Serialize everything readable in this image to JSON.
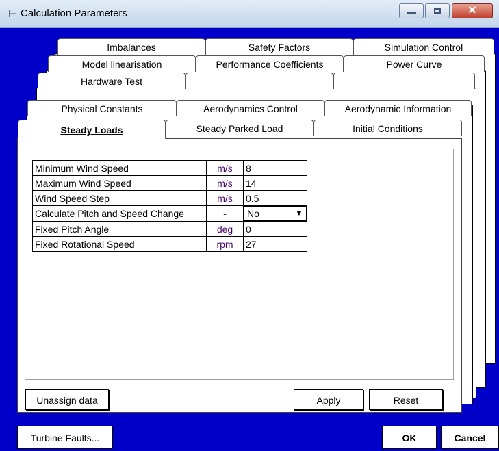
{
  "window": {
    "title": "Calculation Parameters",
    "close_glyph": "✕",
    "app_icon": "wind-turbine-icon"
  },
  "tabs": {
    "row1": [
      "Imbalances",
      "Safety Factors",
      "Simulation Control"
    ],
    "row2": [
      "Model linearisation",
      "Performance Coefficients",
      "Power Curve"
    ],
    "row3": [
      "Hardware Test",
      "",
      ""
    ],
    "row4": [
      "Physical Constants",
      "Aerodynamics Control",
      "Aerodynamic Information"
    ],
    "row5": [
      "Steady Loads",
      "Steady Parked Load",
      "Initial Conditions"
    ],
    "active": "Steady Loads"
  },
  "parameters": [
    {
      "name": "Minimum Wind Speed",
      "unit": "m/s",
      "value": "8"
    },
    {
      "name": "Maximum Wind Speed",
      "unit": "m/s",
      "value": "14"
    },
    {
      "name": "Wind Speed Step",
      "unit": "m/s",
      "value": "0.5"
    },
    {
      "name": "Calculate Pitch and Speed Change",
      "unit": "-",
      "value": "No"
    },
    {
      "name": "Fixed Pitch Angle",
      "unit": "deg",
      "value": "0"
    },
    {
      "name": "Fixed Rotational Speed",
      "unit": "rpm",
      "value": "27"
    }
  ],
  "buttons": {
    "unassign": "Unassign data",
    "apply": "Apply",
    "reset": "Reset",
    "turbine_faults": "Turbine Faults...",
    "ok": "OK",
    "cancel": "Cancel"
  },
  "colors": {
    "background": "#0000c8",
    "unit_text": "#4a0a6a"
  }
}
